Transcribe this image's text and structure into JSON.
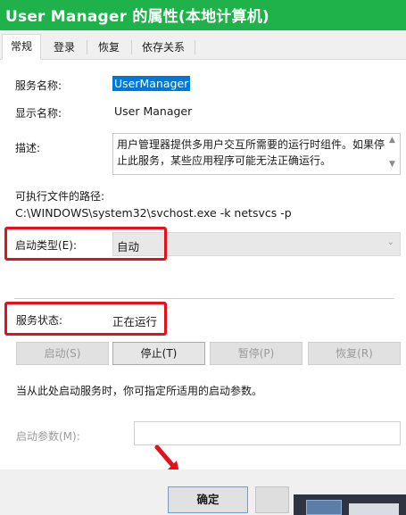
{
  "window": {
    "title": "User Manager 的属性(本地计算机)"
  },
  "tabs": [
    {
      "label": "常规",
      "active": true
    },
    {
      "label": "登录",
      "active": false
    },
    {
      "label": "恢复",
      "active": false
    },
    {
      "label": "依存关系",
      "active": false
    }
  ],
  "general": {
    "service_name_label": "服务名称:",
    "service_name": "UserManager",
    "display_name_label": "显示名称:",
    "display_name": "User Manager",
    "description_label": "描述:",
    "description": "用户管理器提供多用户交互所需要的运行时组件。如果停止此服务，某些应用程序可能无法正确运行。",
    "path_label": "可执行文件的路径:",
    "path": "C:\\WINDOWS\\system32\\svchost.exe -k netsvcs -p",
    "startup_type_label": "启动类型(E):",
    "startup_type": "自动",
    "status_label": "服务状态:",
    "status": "正在运行",
    "buttons": {
      "start": "启动(S)",
      "stop": "停止(T)",
      "pause": "暂停(P)",
      "resume": "恢复(R)"
    },
    "hint": "当从此处启动服务时，你可指定所适用的启动参数。",
    "params_label": "启动参数(M):",
    "params_value": ""
  },
  "footer": {
    "ok": "确定"
  },
  "colors": {
    "titlebar": "#1fb24a",
    "highlight": "#e5101c",
    "selection": "#0078d7"
  }
}
